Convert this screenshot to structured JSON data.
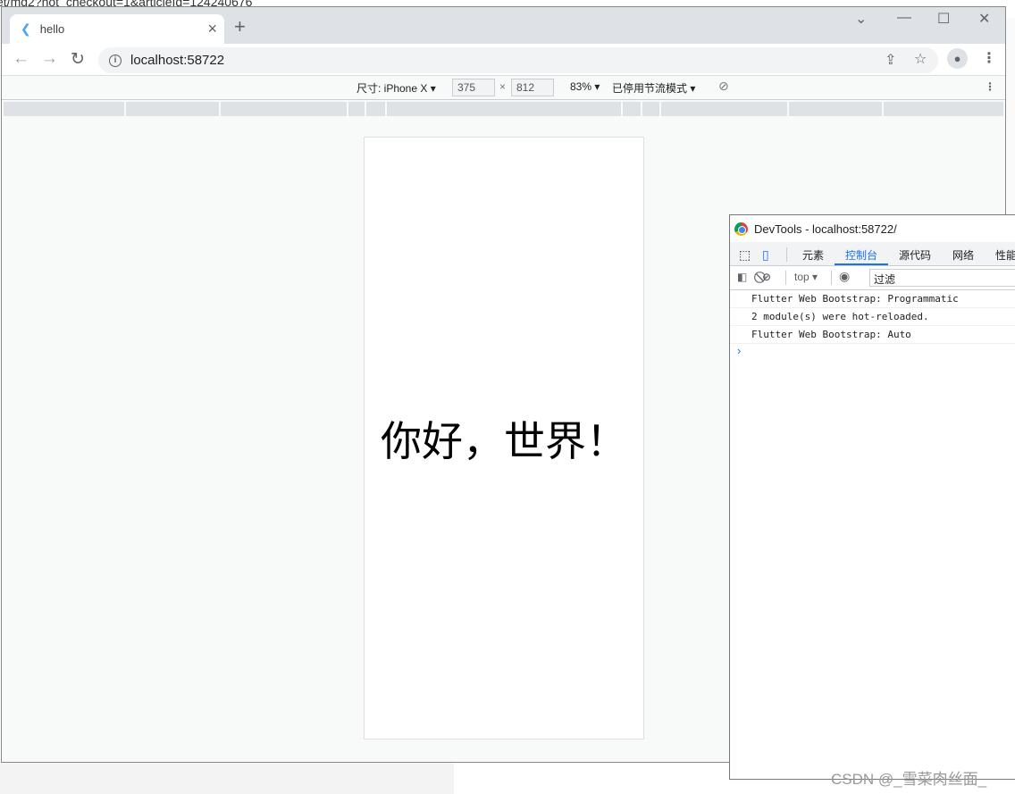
{
  "background": {
    "url_fragment": "et/md2?not_checkout=1&articleId=124240676"
  },
  "browser": {
    "tab_title": "hello",
    "url": "localhost:58722",
    "new_tab": "+"
  },
  "device_toolbar": {
    "dimensions": "尺寸: iPhone X",
    "width": "375",
    "height": "812",
    "times": "×",
    "zoom": "83%",
    "throttle": "已停用节流模式"
  },
  "app": {
    "text": "你好，世界！"
  },
  "devtools": {
    "title": "DevTools - localhost:58722/",
    "tabs": [
      "元素",
      "控制台",
      "源代码",
      "网络",
      "性能"
    ],
    "active_tab": "控制台",
    "context": "top",
    "filter_placeholder": "过滤",
    "console": [
      "Flutter Web Bootstrap: Programmatic",
      "2 module(s) were hot-reloaded.",
      "Flutter Web Bootstrap: Auto"
    ],
    "prompt": "›"
  },
  "watermark": "CSDN @_雪菜肉丝面_"
}
